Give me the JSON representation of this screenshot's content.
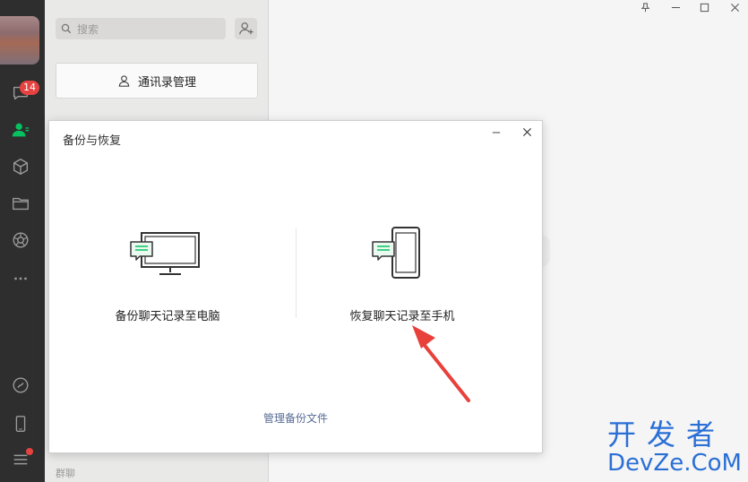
{
  "sidebar": {
    "unread_count": "14"
  },
  "contacts": {
    "search_placeholder": "搜索",
    "address_book_button": "通讯录管理",
    "group_label": "群聊"
  },
  "dialog": {
    "title": "备份与恢复",
    "backup_option": "备份聊天记录至电脑",
    "restore_option": "恢复聊天记录至手机",
    "manage_link": "管理备份文件"
  },
  "watermark": {
    "top": "开发者",
    "bottom": "DevZe.CoM"
  },
  "colors": {
    "sidebar_bg": "#2e2e2e",
    "accent_green": "#07c160",
    "badge_red": "#e64340",
    "link_blue": "#576b95",
    "arrow_red": "#e8413b",
    "watermark_blue": "#2a6fd6"
  }
}
